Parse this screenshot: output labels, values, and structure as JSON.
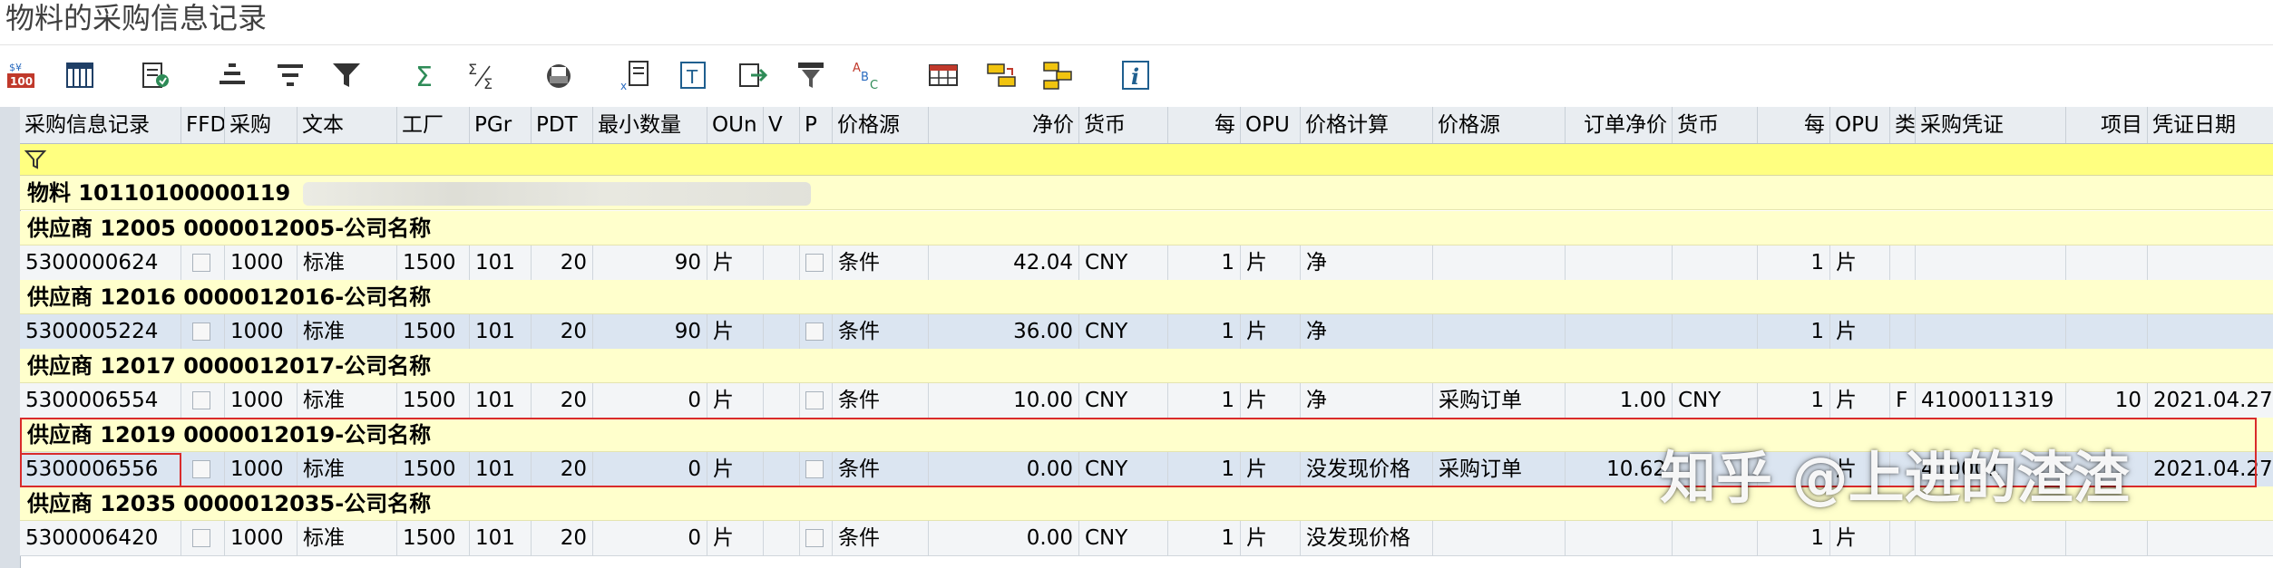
{
  "window": {
    "title": "物料的采购信息记录"
  },
  "toolbar": {
    "icons": [
      "calc-100-icon",
      "select-columns-icon",
      "details-icon",
      "sort-ascending-icon",
      "sort-descending-icon",
      "filter-icon",
      "sum-icon",
      "subtotal-icon",
      "print-icon",
      "export-icon",
      "text-icon",
      "send-icon",
      "layout-filter-icon",
      "abc-icon",
      "table-view-icon",
      "select-layout-icon",
      "change-layout-icon",
      "info-icon"
    ]
  },
  "columns": [
    "采购信息记录",
    "FFD",
    "采购",
    "文本",
    "工厂",
    "PGr",
    "PDT",
    "最小数量",
    "OUn",
    "V",
    "P",
    "价格源",
    "净价",
    "货币",
    "每",
    "OPU",
    "价格计算",
    "价格源",
    "订单净价",
    "货币",
    "每",
    "OPU",
    "类",
    "采购凭证",
    "项目",
    "凭证日期"
  ],
  "material": {
    "label": "物料 10110100000119"
  },
  "groups": [
    {
      "header": "供应商 12005 0000012005-公司名称",
      "row": {
        "record": "5300000624",
        "purch": "1000",
        "text": "标准",
        "plant": "1500",
        "pgr": "101",
        "pdt": "20",
        "minqty": "90",
        "oun": "片",
        "pricesrc": "条件",
        "netprice": "42.04",
        "currency": "CNY",
        "per": "1",
        "opu": "片",
        "pricecalc": "净",
        "pricesrc2": "",
        "ordernet": "",
        "currency2": "",
        "per2": "1",
        "opu2": "片",
        "type": "",
        "doc": "",
        "item": "",
        "date": ""
      }
    },
    {
      "header": "供应商 12016 0000012016-公司名称",
      "row": {
        "record": "5300005224",
        "purch": "1000",
        "text": "标准",
        "plant": "1500",
        "pgr": "101",
        "pdt": "20",
        "minqty": "90",
        "oun": "片",
        "pricesrc": "条件",
        "netprice": "36.00",
        "currency": "CNY",
        "per": "1",
        "opu": "片",
        "pricecalc": "净",
        "pricesrc2": "",
        "ordernet": "",
        "currency2": "",
        "per2": "1",
        "opu2": "片",
        "type": "",
        "doc": "",
        "item": "",
        "date": ""
      }
    },
    {
      "header": "供应商 12017 0000012017-公司名称",
      "row": {
        "record": "5300006554",
        "purch": "1000",
        "text": "标准",
        "plant": "1500",
        "pgr": "101",
        "pdt": "20",
        "minqty": "0",
        "oun": "片",
        "pricesrc": "条件",
        "netprice": "10.00",
        "currency": "CNY",
        "per": "1",
        "opu": "片",
        "pricecalc": "净",
        "pricesrc2": "采购订单",
        "ordernet": "1.00",
        "currency2": "CNY",
        "per2": "1",
        "opu2": "片",
        "type": "F",
        "doc": "4100011319",
        "item": "10",
        "date": "2021.04.27"
      }
    },
    {
      "header": "供应商 12019 0000012019-公司名称",
      "row": {
        "record": "5300006556",
        "purch": "1000",
        "text": "标准",
        "plant": "1500",
        "pgr": "101",
        "pdt": "20",
        "minqty": "0",
        "oun": "片",
        "pricesrc": "条件",
        "netprice": "0.00",
        "currency": "CNY",
        "per": "1",
        "opu": "片",
        "pricecalc": "没发现价格",
        "pricesrc2": "采购订单",
        "ordernet": "10.62",
        "currency2": "",
        "per2": "",
        "opu2": "片",
        "type": "",
        "doc": "410001",
        "item": "",
        "date": "2021.04.27"
      }
    },
    {
      "header": "供应商 12035 0000012035-公司名称",
      "row": {
        "record": "5300006420",
        "purch": "1000",
        "text": "标准",
        "plant": "1500",
        "pgr": "101",
        "pdt": "20",
        "minqty": "0",
        "oun": "片",
        "pricesrc": "条件",
        "netprice": "0.00",
        "currency": "CNY",
        "per": "1",
        "opu": "片",
        "pricecalc": "没发现价格",
        "pricesrc2": "",
        "ordernet": "",
        "currency2": "",
        "per2": "1",
        "opu2": "片",
        "type": "",
        "doc": "",
        "item": "",
        "date": ""
      }
    }
  ],
  "watermark": {
    "text": "知乎 @上进的渣渣"
  },
  "colors": {
    "filter_row": "#ffff80",
    "group_row": "#ffffcc",
    "row_alt": "#dbe5f1",
    "highlight_box": "#d92b2b"
  }
}
